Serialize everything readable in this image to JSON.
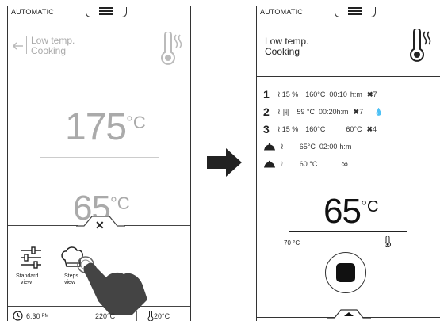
{
  "left": {
    "mode": "AUTOMATIC",
    "title_line1": "Low temp.",
    "title_line2": "Cooking",
    "main_temp": "175",
    "main_unit": "°C",
    "second_temp": "65",
    "second_unit": "°C",
    "view_options": [
      {
        "label_line1": "Standard",
        "label_line2": "view"
      },
      {
        "label_line1": "Steps",
        "label_line2": "view"
      }
    ],
    "status": {
      "time": "6:30",
      "time_suffix": "PM",
      "oven_temp": "220°C",
      "probe_temp": "20°C"
    }
  },
  "right": {
    "mode": "AUTOMATIC",
    "title_line1": "Low temp.",
    "title_line2": "Cooking",
    "steps": [
      {
        "num": "1",
        "humidity": "15 %",
        "temp": "160°C",
        "time": "00:10",
        "unit": "h:m",
        "fan": "7"
      },
      {
        "num": "2",
        "temp": "59 °C",
        "time": "00:20",
        "unit": "h:m",
        "fan": "7"
      },
      {
        "num": "3",
        "humidity": "15 %",
        "temp": "160°C",
        "core": "60°C",
        "fan": "4"
      },
      {
        "temp": "65°C",
        "time": "02:00",
        "unit": "h:m"
      },
      {
        "temp": "60 °C"
      }
    ],
    "core_temp": "65",
    "core_unit": "°C",
    "core_set": "70 °C"
  },
  "colors": {
    "dark": "#222222",
    "grey": "#aaaaaa",
    "line": "#333333"
  }
}
